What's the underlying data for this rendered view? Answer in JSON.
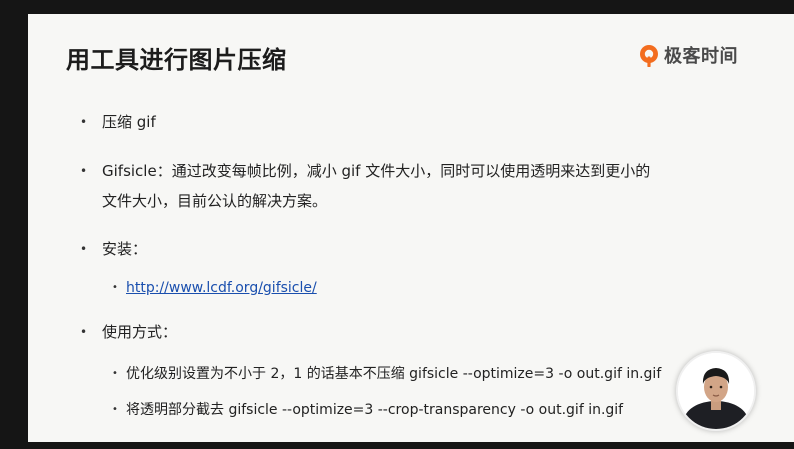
{
  "slide": {
    "title": "用工具进行图片压缩",
    "brand": {
      "name": "极客时间",
      "icon": "geektime-logo-icon",
      "color": "#f36d1f"
    },
    "bullets": [
      {
        "text": "压缩 gif"
      },
      {
        "line1": "Gifsicle：通过改变每帧比例，减小 gif 文件大小，同时可以使用透明来达到更小的",
        "line2": "文件大小，目前公认的解决方案。"
      },
      {
        "text": "安装："
      },
      {
        "link": "http://www.lcdf.org/gifsicle/"
      },
      {
        "text": "使用方式："
      },
      {
        "text": "优化级别设置为不小于 2，1 的话基本不压缩  gifsicle --optimize=3 -o out.gif in.gif"
      },
      {
        "text": "将透明部分截去 gifsicle --optimize=3 --crop-transparency -o out.gif in.gif"
      }
    ]
  },
  "presenter": {
    "icon": "presenter-avatar"
  },
  "colors": {
    "background": "#151515",
    "slide": "#f7f7f5",
    "link": "#1a4fae"
  }
}
